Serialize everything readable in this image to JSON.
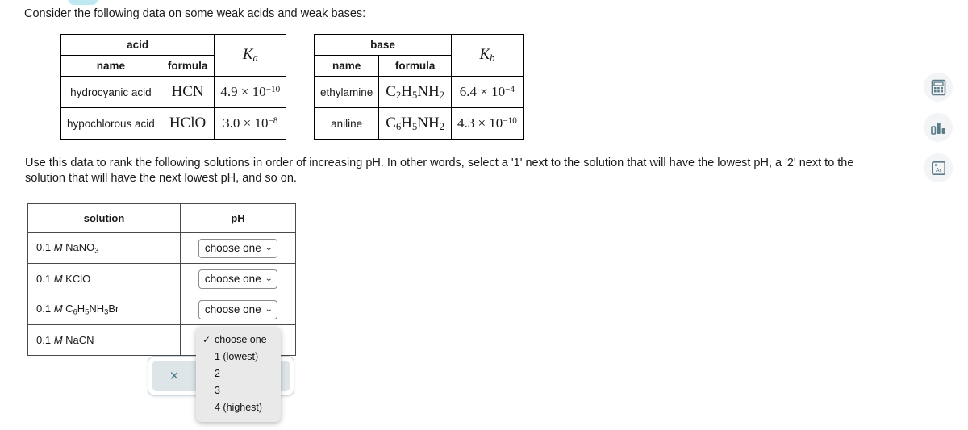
{
  "intro": "Consider the following data on some weak acids and weak bases:",
  "acid_table": {
    "group_header": "acid",
    "k_header_base": "K",
    "k_header_sub": "a",
    "columns": [
      "name",
      "formula"
    ],
    "rows": [
      {
        "name": "hydrocyanic acid",
        "formula": "HCN",
        "mantissa": "4.9 × 10",
        "exponent": "−10"
      },
      {
        "name": "hypochlorous acid",
        "formula": "HClO",
        "mantissa": "3.0 × 10",
        "exponent": "−8"
      }
    ]
  },
  "base_table": {
    "group_header": "base",
    "k_header_base": "K",
    "k_header_sub": "b",
    "columns": [
      "name",
      "formula"
    ],
    "rows": [
      {
        "name": "ethylamine",
        "formula_parts": [
          "C",
          "2",
          "H",
          "5",
          "NH",
          "2"
        ],
        "mantissa": "6.4 × 10",
        "exponent": "−4"
      },
      {
        "name": "aniline",
        "formula_parts": [
          "C",
          "6",
          "H",
          "5",
          "NH",
          "2"
        ],
        "mantissa": "4.3 × 10",
        "exponent": "−10"
      }
    ]
  },
  "instructions": "Use this data to rank the following solutions in order of increasing pH. In other words, select a '1' next to the solution that will have the lowest pH, a '2' next to the solution that will have the next lowest pH, and so on.",
  "solution_table": {
    "headers": [
      "solution",
      "pH"
    ],
    "rows": [
      {
        "conc": "0.1",
        "unit": "M",
        "formula_base": "NaNO",
        "formula_sub": "3",
        "formula_tail": "",
        "select_value": "choose one"
      },
      {
        "conc": "0.1",
        "unit": "M",
        "formula_base": "KClO",
        "formula_sub": "",
        "formula_tail": "",
        "select_value": "choose one"
      },
      {
        "conc": "0.1",
        "unit": "M",
        "formula_base": "C",
        "formula_sub": "6",
        "formula_tail": "H5NH3Br",
        "select_value": "choose one"
      },
      {
        "conc": "0.1",
        "unit": "M",
        "formula_base": "NaCN",
        "formula_sub": "",
        "formula_tail": "",
        "select_value": "choose one"
      }
    ]
  },
  "dropdown": {
    "selected": "choose one",
    "check_glyph": "✓",
    "options": [
      "choose one",
      "1 (lowest)",
      "2",
      "3",
      "4 (highest)"
    ]
  },
  "reset_button": {
    "glyph": "×"
  },
  "select_chevron": "⌄",
  "rail": {
    "items": [
      {
        "icon": "calculator-icon"
      },
      {
        "icon": "bar-chart-icon"
      },
      {
        "icon": "periodic-table-icon",
        "label": "Ar"
      }
    ]
  },
  "colors": {
    "pill": "#bfe9f2",
    "button_fill": "#dde5e8",
    "button_glyph": "#4b7c88",
    "menu_bg": "#e9e9e9",
    "rail_bg": "#f2f4f5",
    "rail_icon": "#5c7c8a"
  }
}
